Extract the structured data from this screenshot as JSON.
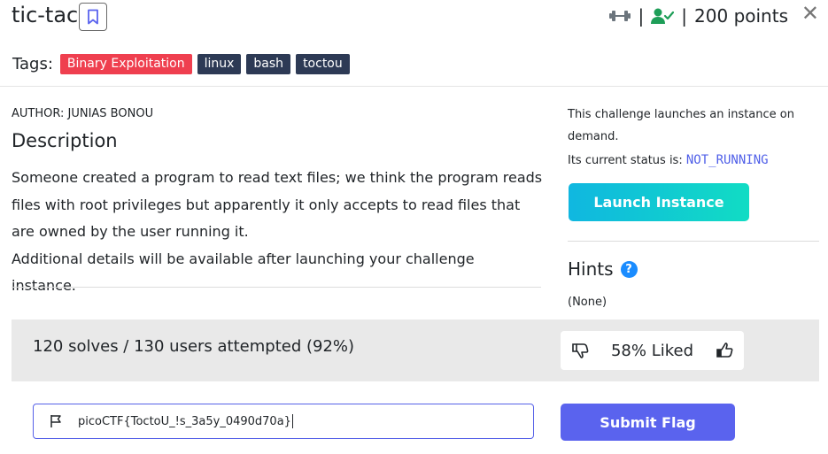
{
  "challenge": {
    "title": "tic-tac",
    "points_label": "200 points",
    "separator": "|",
    "close_glyph": "✕"
  },
  "tags": {
    "label": "Tags:",
    "items": [
      {
        "label": "Binary Exploitation",
        "color": "#ef3f4f"
      },
      {
        "label": "linux",
        "color": "#2d3a55"
      },
      {
        "label": "bash",
        "color": "#2d3a55"
      },
      {
        "label": "toctou",
        "color": "#2d3a55"
      }
    ]
  },
  "author": "AUTHOR: JUNIAS BONOU",
  "description": {
    "heading": "Description",
    "paragraph1": "Someone created a program to read text files; we think the program reads files with root privileges but apparently it only accepts to read files that are owned by the user running it.",
    "paragraph2": "Additional details will be available after launching your challenge instance."
  },
  "instance": {
    "info": "This challenge launches an instance on demand.",
    "status_prefix": "Its current status is:",
    "status_value": "NOT_RUNNING",
    "launch_label": "Launch Instance"
  },
  "hints": {
    "heading": "Hints",
    "help_glyph": "?",
    "value": "(None)"
  },
  "stats": {
    "solves": "120 solves / 130 users attempted (92%)",
    "liked": "58% Liked"
  },
  "flag": {
    "value": "picoCTF{ToctoU_!s_3a5y_0490d70a}",
    "submit_label": "Submit Flag"
  },
  "colors": {
    "accent": "#5a63ee",
    "status": "#4f5fe8",
    "launch_gradient_start": "#10b7e0",
    "launch_gradient_end": "#11dcc4",
    "solved_check": "#1e9e58"
  },
  "icons": {
    "bookmark": "bookmark-icon",
    "difficulty": "dumbbell-icon",
    "solved": "user-check-icon",
    "close": "close-icon",
    "help": "help-circle-icon",
    "dislike": "thumbs-down-icon",
    "like": "thumbs-up-icon",
    "flag": "flag-icon"
  }
}
